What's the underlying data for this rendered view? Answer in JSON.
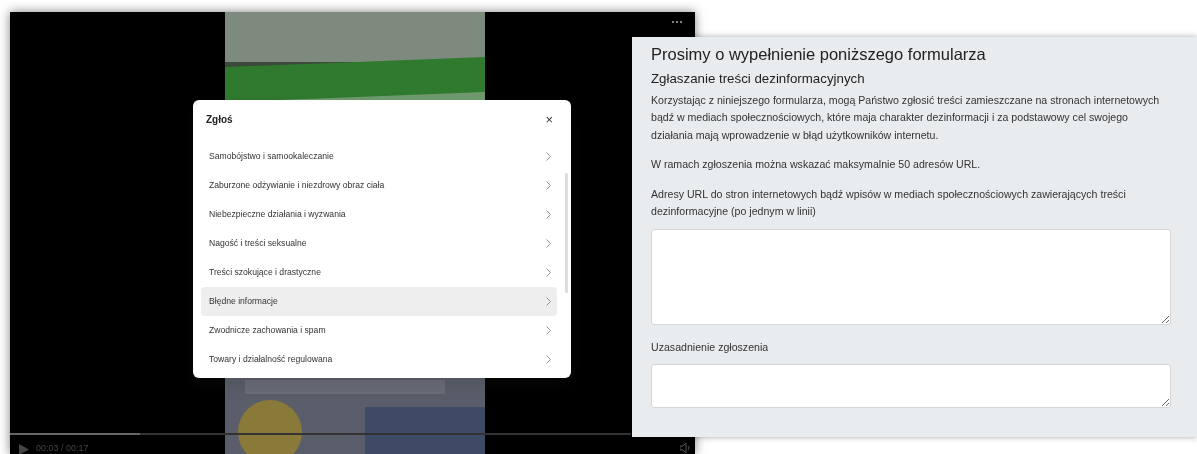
{
  "video_player": {
    "time": "00:03 / 00:17",
    "progress": {
      "level": 0.21
    }
  },
  "report_dialog": {
    "title": "Zgłoś",
    "close": "×",
    "items": [
      {
        "label": "Samobójstwo i samookaleczanie",
        "selected": false
      },
      {
        "label": "Zaburzone odżywianie i niezdrowy obraz ciała",
        "selected": false
      },
      {
        "label": "Niebezpieczne działania i wyzwania",
        "selected": false
      },
      {
        "label": "Nagość i treści seksualne",
        "selected": false
      },
      {
        "label": "Treści szokujące i drastyczne",
        "selected": false
      },
      {
        "label": "Błędne informacje",
        "selected": true
      },
      {
        "label": "Zwodnicze zachowania i spam",
        "selected": false
      },
      {
        "label": "Towary i działalność regulowana",
        "selected": false
      }
    ]
  },
  "form": {
    "title": "Prosimy o wypełnienie poniższego formularza",
    "subtitle": "Zgłaszanie treści dezinformacyjnych",
    "paragraphs": [
      "Korzystając z niniejszego formularza, mogą Państwo zgłosić treści zamieszczane na stronach internetowych bądź w mediach społecznościowych, które maja charakter dezinformacji i za podstawowy cel swojego działania mają wprowadzenie w błąd użytkowników internetu.",
      "W ramach zgłoszenia można wskazać maksymalnie 50 adresów URL."
    ],
    "fields": [
      {
        "label": "Adresy URL do stron internetowych bądź wpisów w mediach społecznościowych zawierających treści dezinformacyjne (po jednym w linii)"
      },
      {
        "label": "Uzasadnienie zgłoszenia"
      }
    ]
  }
}
